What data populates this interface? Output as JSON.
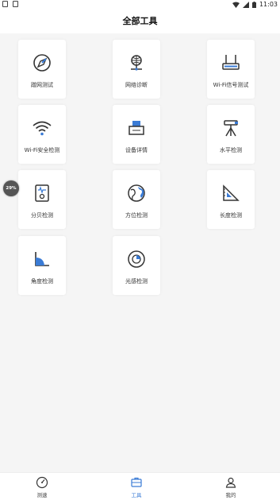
{
  "status_bar": {
    "time": "11:03"
  },
  "header": {
    "title": "全部工具"
  },
  "tools": [
    {
      "label": "蹭网测试",
      "icon": "compass-icon"
    },
    {
      "label": "网络诊断",
      "icon": "network-icon"
    },
    {
      "label": "Wi-Fi信号测试",
      "icon": "router-icon"
    },
    {
      "label": "Wi-Fi安全检测",
      "icon": "wifi-icon"
    },
    {
      "label": "设备详情",
      "icon": "device-icon"
    },
    {
      "label": "水平检测",
      "icon": "tripod-icon"
    },
    {
      "label": "分贝检测",
      "icon": "decibel-meter-icon"
    },
    {
      "label": "方位检测",
      "icon": "globe-icon"
    },
    {
      "label": "长度检测",
      "icon": "ruler-triangle-icon"
    },
    {
      "label": "角度检测",
      "icon": "angle-icon"
    },
    {
      "label": "光感检测",
      "icon": "light-sensor-icon"
    }
  ],
  "float_badge": {
    "text": "29%"
  },
  "bottom_nav": {
    "items": [
      {
        "label": "测速",
        "icon": "speedometer-icon",
        "active": false
      },
      {
        "label": "工具",
        "icon": "toolbox-icon",
        "active": true
      },
      {
        "label": "我的",
        "icon": "user-icon",
        "active": false
      }
    ]
  },
  "colors": {
    "accent": "#3a7bd5",
    "icon_stroke": "#333333"
  }
}
